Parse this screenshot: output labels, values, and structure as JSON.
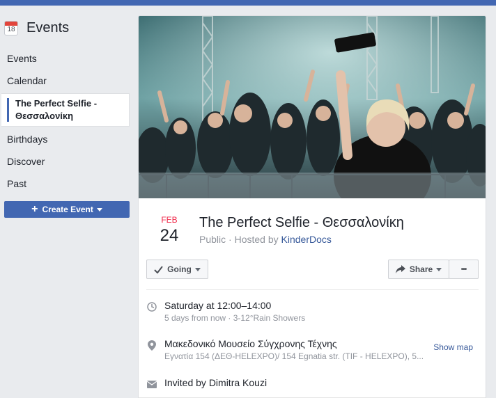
{
  "sidebar": {
    "calendar_icon_day": "18",
    "title": "Events",
    "items": [
      {
        "label": "Events"
      },
      {
        "label": "Calendar"
      },
      {
        "label": "The Perfect Selfie - Θεσσαλονίκη"
      },
      {
        "label": "Birthdays"
      },
      {
        "label": "Discover"
      },
      {
        "label": "Past"
      }
    ],
    "create_button": "Create Event"
  },
  "event": {
    "month": "FEB",
    "day": "24",
    "title": "The Perfect Selfie - Θεσσαλονίκη",
    "visibility": "Public",
    "hosted_by_prefix": "· Hosted by",
    "host": "KinderDocs",
    "going_label": "Going",
    "share_label": "Share",
    "more_label": "•••",
    "time": "Saturday at 12:00–14:00",
    "time_sub": "5 days from now · 3-12°Rain Showers",
    "location": "Μακεδονικό Μουσείο Σύγχρονης Τέχνης",
    "address": "Εγνατία 154 (ΔΕΘ-HELEXPO)/ 154 Egnatia str. (TIF - HELEXPO), 5...",
    "show_map": "Show map",
    "invited": "Invited by Dimitra Kouzi"
  },
  "colors": {
    "brand": "#4267b2",
    "link": "#365899",
    "date_month": "#f02849"
  },
  "icons": [
    "calendar-icon",
    "plus-icon",
    "check-icon",
    "share-icon",
    "clock-icon",
    "location-pin-icon",
    "envelope-icon"
  ]
}
